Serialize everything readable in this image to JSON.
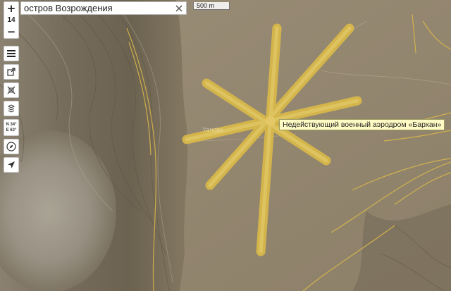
{
  "search": {
    "value": "остров Возрождения",
    "placeholder": ""
  },
  "scale": {
    "label": "500 m"
  },
  "zoom": {
    "in_label": "+",
    "level": "14",
    "out_label": "−"
  },
  "toolbar": {
    "icons": [
      "menu-icon",
      "share-icon",
      "layers-icon",
      "stack-icon",
      "coordinates-icon",
      "compass-icon",
      "locate-icon"
    ]
  },
  "coords": {
    "lat": "N 34°",
    "lon": "E 62°"
  },
  "tooltip": {
    "text": "Недействующий военный аэродром «Бархан»"
  },
  "watermark": {
    "text": "Yandex"
  },
  "colors": {
    "runway": "#d7b84a",
    "runway_fill": "#dcc05a",
    "road": "#d9b64a",
    "terrain_dark": "#6f6656",
    "terrain_plain": "#9a8d76",
    "tooltip_bg": "#fffbc4"
  }
}
